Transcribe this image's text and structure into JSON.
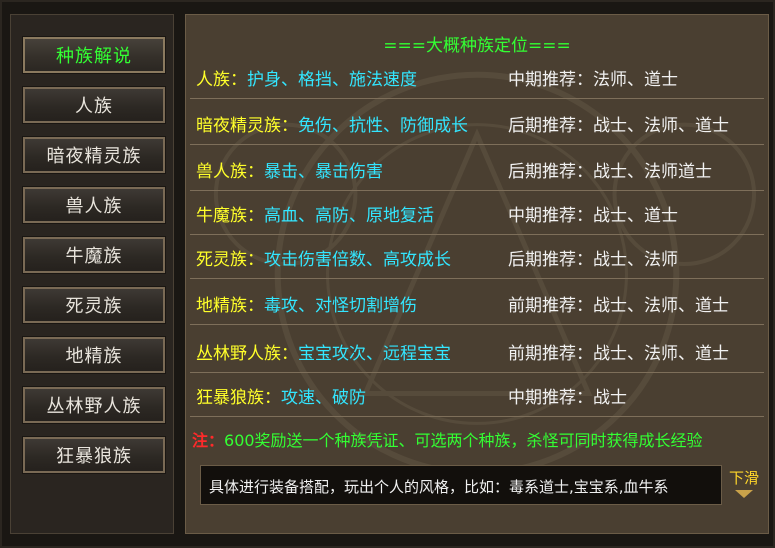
{
  "sidebar": {
    "items": [
      {
        "label": "种族解说"
      },
      {
        "label": "人族"
      },
      {
        "label": "暗夜精灵族"
      },
      {
        "label": "兽人族"
      },
      {
        "label": "牛魔族"
      },
      {
        "label": "死灵族"
      },
      {
        "label": "地精族"
      },
      {
        "label": "丛林野人族"
      },
      {
        "label": "狂暴狼族"
      }
    ],
    "active_index": 0
  },
  "content": {
    "heading": "===大概种族定位===",
    "rows": [
      {
        "name": "人族：",
        "traits": "护身、格挡、施法速度",
        "rec": "中期推荐：法师、道士"
      },
      {
        "name": "暗夜精灵族：",
        "traits": "免伤、抗性、防御成长",
        "rec": "后期推荐：战士、法师、道士"
      },
      {
        "name": "兽人族：",
        "traits": "暴击、暴击伤害",
        "rec": "后期推荐：战士、法师道士"
      },
      {
        "name": "牛魔族：",
        "traits": "高血、高防、原地复活",
        "rec": "中期推荐：战士、道士"
      },
      {
        "name": "死灵族：",
        "traits": "攻击伤害倍数、高攻成长",
        "rec": "后期推荐：战士、法师"
      },
      {
        "name": "地精族：",
        "traits": "毒攻、对怪切割增伤",
        "rec": "前期推荐：战士、法师、道士"
      },
      {
        "name": "丛林野人族：",
        "traits": "宝宝攻次、远程宝宝",
        "rec": "前期推荐：战士、法师、道士"
      },
      {
        "name": "狂暴狼族：",
        "traits": "攻速、破防",
        "rec": "中期推荐：战士"
      }
    ],
    "note_prefix": "注：",
    "note_body": "600奖励送一个种族凭证、可选两个种族，杀怪可同时获得成长经验",
    "scroll_text": "具体进行装备搭配，玩出个人的风格，比如：毒系道士,宝宝系,血牛系",
    "scroll_label": "下滑"
  },
  "colors": {
    "active_label": "#33ff33",
    "race_name": "#ffff2a",
    "race_traits": "#33e6ff",
    "note_prefix": "#ff2a2a",
    "note_body": "#33ff33"
  }
}
